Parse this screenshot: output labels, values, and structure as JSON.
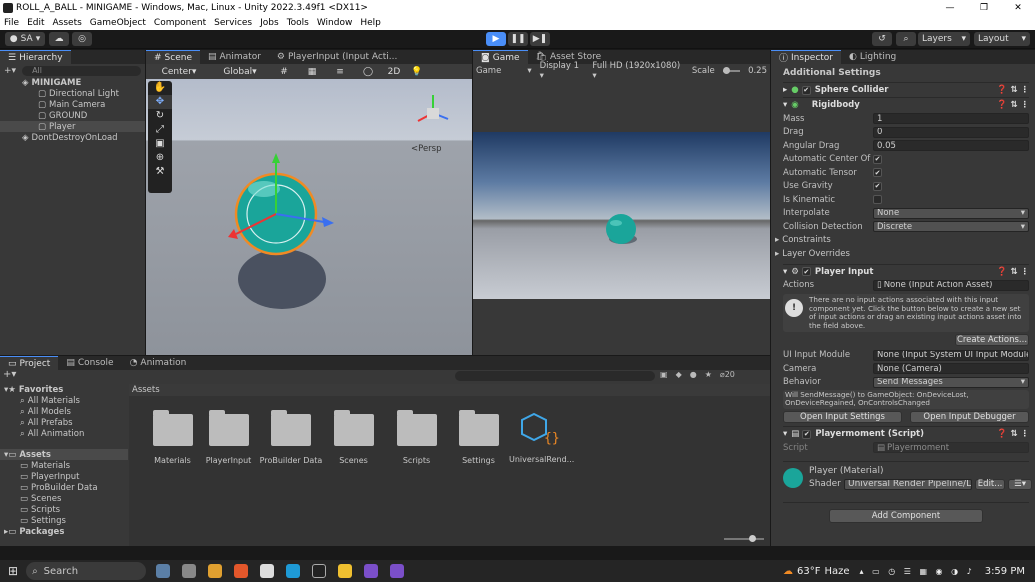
{
  "window": {
    "title": "ROLL_A_BALL - MINIGAME - Windows, Mac, Linux - Unity 2022.3.49f1 <DX11>"
  },
  "menu": [
    "File",
    "Edit",
    "Assets",
    "GameObject",
    "Component",
    "Services",
    "Jobs",
    "Tools",
    "Window",
    "Help"
  ],
  "toolbar": {
    "account": "SA",
    "layers": "Layers",
    "layout": "Layout"
  },
  "hierarchy": {
    "tab": "Hierarchy",
    "search_placeholder": "All",
    "scene": "MINIGAME",
    "items": [
      "Directional Light",
      "Main Camera",
      "GROUND",
      "Player"
    ],
    "ddol": "DontDestroyOnLoad"
  },
  "scene_tabs": {
    "scene": "Scene",
    "animator": "Animator",
    "playerinput": "PlayerInput (Input Acti..."
  },
  "scene_toolbar": {
    "pivot": "Center",
    "space": "Global",
    "mode2d": "2D"
  },
  "scene_view": {
    "persp": "<Persp"
  },
  "game_tabs": {
    "game": "Game",
    "store": "Asset Store"
  },
  "game_toolbar": {
    "mode": "Game",
    "display": "Display 1",
    "resolution": "Full HD (1920x1080)",
    "scale_label": "Scale",
    "scale_value": "0.25"
  },
  "project": {
    "tabs": [
      "Project",
      "Console",
      "Animation"
    ],
    "favorites": "Favorites",
    "fav_items": [
      "All Materials",
      "All Models",
      "All Prefabs",
      "All Animation"
    ],
    "assets": "Assets",
    "asset_items": [
      "Materials",
      "PlayerInput",
      "ProBuilder Data",
      "Scenes",
      "Scripts",
      "Settings"
    ],
    "packages": "Packages",
    "header": "Assets",
    "count": "20",
    "grid": [
      "Materials",
      "PlayerInput",
      "ProBuilder Data",
      "Scenes",
      "Scripts",
      "Settings",
      "UniversalRend..."
    ]
  },
  "inspector": {
    "tabs": {
      "inspector": "Inspector",
      "lighting": "Lighting"
    },
    "additional": "Additional Settings",
    "sphere_collider": "Sphere Collider",
    "rigidbody": "Rigidbody",
    "rb_fields": [
      {
        "label": "Mass",
        "value": "1"
      },
      {
        "label": "Drag",
        "value": "0"
      },
      {
        "label": "Angular Drag",
        "value": "0.05"
      }
    ],
    "rb_toggles": [
      {
        "label": "Automatic Center Of M",
        "checked": "✔"
      },
      {
        "label": "Automatic Tensor",
        "checked": "✔"
      },
      {
        "label": "Use Gravity",
        "checked": "✔"
      },
      {
        "label": "Is Kinematic",
        "checked": ""
      }
    ],
    "interpolate": {
      "label": "Interpolate",
      "value": "None"
    },
    "collision": {
      "label": "Collision Detection",
      "value": "Discrete"
    },
    "constraints": "Constraints",
    "layer_overrides": "Layer Overrides",
    "player_input": "Player Input",
    "actions_label": "Actions",
    "actions_value": "None (Input Action Asset)",
    "help_text": "There are no input actions associated with this input component yet. Click the button below to create a new set of input actions or drag an existing input actions asset into the field above.",
    "create_actions": "Create Actions...",
    "ui_module": {
      "label": "UI Input Module",
      "value": "None (Input System UI Input Module)"
    },
    "camera": {
      "label": "Camera",
      "value": "None (Camera)"
    },
    "behavior": {
      "label": "Behavior",
      "value": "Send Messages"
    },
    "behavior_note": "Will SendMessage() to GameObject: OnDeviceLost, OnDeviceRegained, OnControlsChanged",
    "open_settings": "Open Input Settings",
    "open_debugger": "Open Input Debugger",
    "script_comp": "Playermoment (Script)",
    "script_label": "Script",
    "script_value": "Playermoment",
    "material_name": "Player (Material)",
    "shader_label": "Shader",
    "shader_value": "Universal Render Pipeline/L",
    "edit": "Edit...",
    "add_component": "Add Component"
  },
  "taskbar": {
    "search": "Search",
    "weather": "63°F",
    "weather_desc": "Haze",
    "time": "3:59 PM"
  },
  "colors": {
    "accent": "#4a8ef7",
    "ball": "#1aa59a",
    "orange_select": "#f08a24"
  }
}
